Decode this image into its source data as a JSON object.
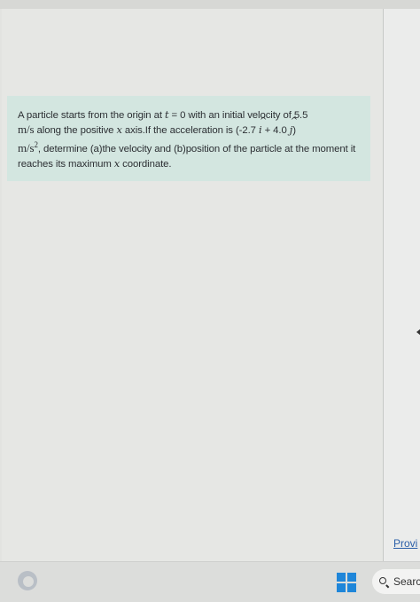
{
  "question": {
    "p1": "A particle starts from the origin at ",
    "t_var": "t",
    "p2": " = 0 with an initial velocity of 5.5",
    "unit_ms": "m/s",
    "p3": " along the positive ",
    "x_var": "x",
    "p4": " axis.If the acceleration is (-2.7 ",
    "i_vec": "i",
    "p5": " + 4.0 ",
    "j_vec": "j",
    "p6": ")",
    "unit_ms2": "m/s",
    "unit_exp": "2",
    "p7": ", determine (a)the velocity and (b)position of the particle at the moment it reaches its maximum ",
    "x_var2": "x",
    "p8": " coordinate."
  },
  "sidebar": {
    "link_label": "Provi"
  },
  "taskbar": {
    "search_label": "Searc"
  },
  "colors": {
    "question_bg": "#d3e6e0",
    "link": "#2b5fa8",
    "windows_accent": "#1f86d9"
  }
}
